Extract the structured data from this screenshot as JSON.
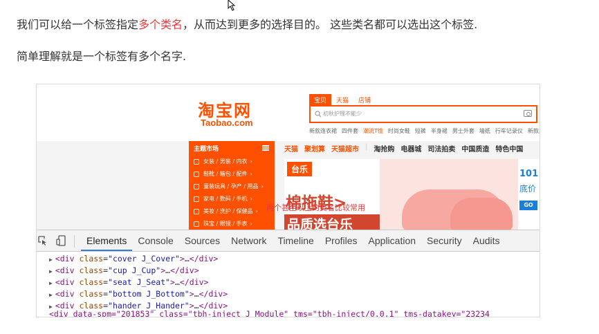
{
  "article": {
    "line1_a": "我们可以给一个标签指定",
    "line1_highlight": "多个类名",
    "line1_b": "，从而达到更多的选择目的。 这些类名都可以选出这个标签.",
    "line2": "简单理解就是一个标签有多个名字."
  },
  "taobao": {
    "logo_cn": "淘宝网",
    "logo_en": "Taobao.com",
    "search_tabs": [
      "宝贝",
      "天猫",
      "店铺"
    ],
    "search_placeholder": "初秋护理不能少",
    "hot_words": [
      "新款连衣裙",
      "四件套",
      "潮流T恤",
      "时尚女鞋",
      "短裤",
      "半身裙",
      "男士外套",
      "墙纸",
      "行车记录仪",
      "新款男鞋"
    ],
    "category_title": "主题市场",
    "categories": [
      "女装 / 男装 / 内衣",
      "鞋靴 / 箱包 / 配件",
      "童装玩具 / 孕产 / 用品",
      "家电 / 数码 / 手机",
      "美妆 / 洗护 / 保健品",
      "珠宝 / 眼镜 / 手表"
    ],
    "nav_orange": [
      "天猫",
      "聚划算",
      "天猫超市"
    ],
    "nav_dark": [
      "淘抢购",
      "电器城",
      "司法拍卖",
      "中国质造",
      "特色中国"
    ],
    "banner_tag": "台乐",
    "banner_title": "棉拖鞋",
    "banner_title_arrow": ">",
    "banner_sub": "品质选台乐",
    "side_ad_number": "101",
    "side_ad_text": "底价",
    "side_ad_button": "GO"
  },
  "devtools": {
    "tabs": [
      "Elements",
      "Console",
      "Sources",
      "Network",
      "Timeline",
      "Profiles",
      "Application",
      "Security",
      "Audits"
    ],
    "active_tab": "Elements",
    "dom_lines": [
      {
        "cls": "\"cover J_Cover\""
      },
      {
        "cls": "\"cup J_Cup\""
      },
      {
        "cls": "\"seat J_Seat\""
      },
      {
        "cls": "\"bottom J_Bottom\""
      },
      {
        "cls": "\"hander J_Hander\""
      }
    ],
    "tag_open": "<div",
    "attr_name": "class",
    "ellipsis": "…",
    "tag_close": "</div>",
    "cut_line": "<div data-spm=\"201853\" class=\"tbh-inject J_Module\" tms=\"tbh-inject/0.0.1\" tms-datakey=\"23234",
    "note": "两个甚至以上的类名比较常用"
  }
}
